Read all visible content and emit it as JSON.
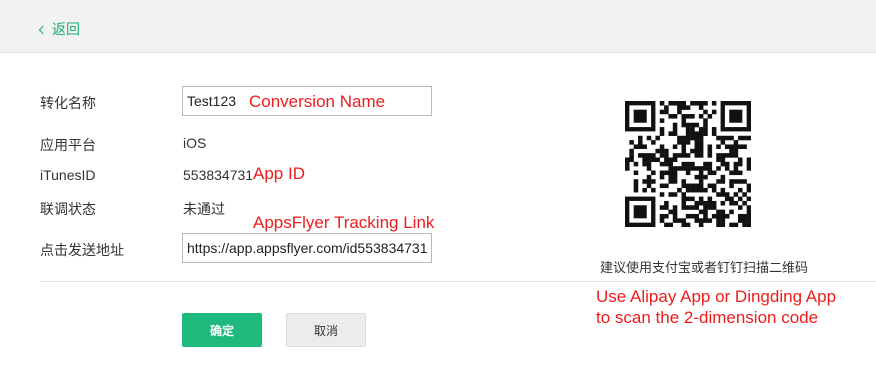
{
  "header": {
    "back_label": "返回"
  },
  "form": {
    "conversion_name_label": "转化名称",
    "conversion_name_value": "Test123",
    "platform_label": "应用平台",
    "platform_value": "iOS",
    "itunes_label": "iTunesID",
    "itunes_value": "553834731",
    "debug_status_label": "联调状态",
    "debug_status_value": "未通过",
    "click_url_label": "点击发送地址",
    "click_url_value": "https://app.appsflyer.com/id553834731"
  },
  "annotations": {
    "conversion_name": "Conversion Name",
    "app_id": "App ID",
    "tracking_link": "AppsFlyer Tracking Link",
    "scan_hint_en_line1": "Use Alipay App or Dingding App",
    "scan_hint_en_line2": "to scan the 2-dimension code"
  },
  "qr": {
    "hint": "建议使用支付宝或者钉钉扫描二维码",
    "icon": "qr-code"
  },
  "buttons": {
    "confirm": "确定",
    "cancel": "取消"
  },
  "colors": {
    "accent": "#1aad6e",
    "annotation": "#ee1c1c",
    "confirm_bg": "#1db97d"
  }
}
